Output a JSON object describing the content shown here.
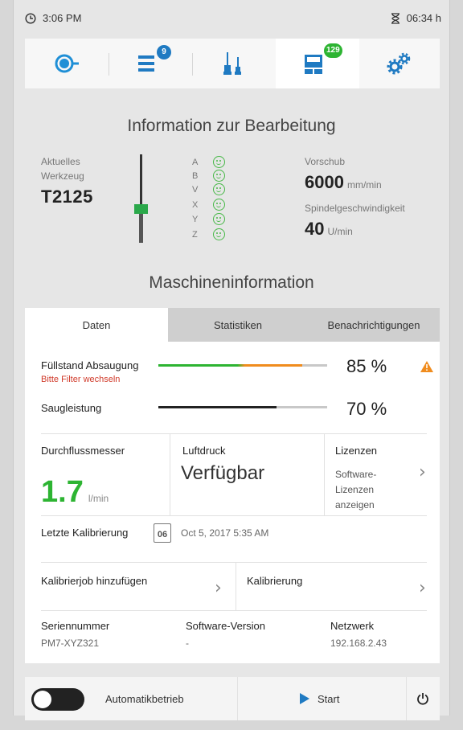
{
  "status": {
    "time": "3:06 PM",
    "duration": "06:34 h"
  },
  "nav": {
    "items": [
      {
        "icon": "machine-icon",
        "badge": ""
      },
      {
        "icon": "job-list-icon",
        "badge": "9"
      },
      {
        "icon": "tools-icon",
        "badge": ""
      },
      {
        "icon": "material-icon",
        "badge": "129"
      },
      {
        "icon": "settings-icon",
        "badge": ""
      }
    ],
    "active_index": 3
  },
  "processing": {
    "title": "Information zur Bearbeitung",
    "current_tool_label_1": "Aktuelles",
    "current_tool_label_2": "Werkzeug",
    "tool_id": "T2125",
    "axes": [
      "A",
      "B",
      "V",
      "X",
      "Y",
      "Z"
    ],
    "feed_label": "Vorschub",
    "feed_value": "6000",
    "feed_unit": "mm/min",
    "spindle_label": "Spindelgeschwindigkeit",
    "spindle_value": "40",
    "spindle_unit": "U/min"
  },
  "machine": {
    "title": "Maschineninformation",
    "tabs": [
      "Daten",
      "Statistiken",
      "Benachrichtigungen"
    ],
    "active_tab": 0,
    "suction_label": "Füllstand Absaugung",
    "suction_warning": "Bitte Filter wechseln",
    "suction_percent": 85,
    "suction_value": "85 %",
    "power_label": "Saugleistung",
    "power_percent": 70,
    "power_value": "70 %",
    "flow_label": "Durchflussmesser",
    "flow_value": "1.7",
    "flow_unit": "l/min",
    "air_label": "Luftdruck",
    "air_value": "Verfügbar",
    "license_label": "Lizenzen",
    "license_link_1": "Software-",
    "license_link_2": "Lizenzen",
    "license_link_3": "anzeigen",
    "calib_last_label": "Letzte Kalibrierung",
    "calendar_day": "06",
    "calib_last_value": "Oct 5, 2017 5:35 AM",
    "add_calib_job": "Kalibrierjob hinzufügen",
    "calibration": "Kalibrierung",
    "serial_label": "Seriennummer",
    "serial_value": "PM7-XYZ321",
    "software_label": "Software-Version",
    "software_value": "-",
    "network_label": "Netzwerk",
    "network_value": "192.168.2.43"
  },
  "footer": {
    "auto_mode": "Automatikbetrieb",
    "auto_mode_on": false,
    "start": "Start"
  },
  "colors": {
    "accent": "#1f7ac2",
    "ok": "#2db432",
    "warning": "#f08c1e",
    "error": "#d03a2a"
  }
}
